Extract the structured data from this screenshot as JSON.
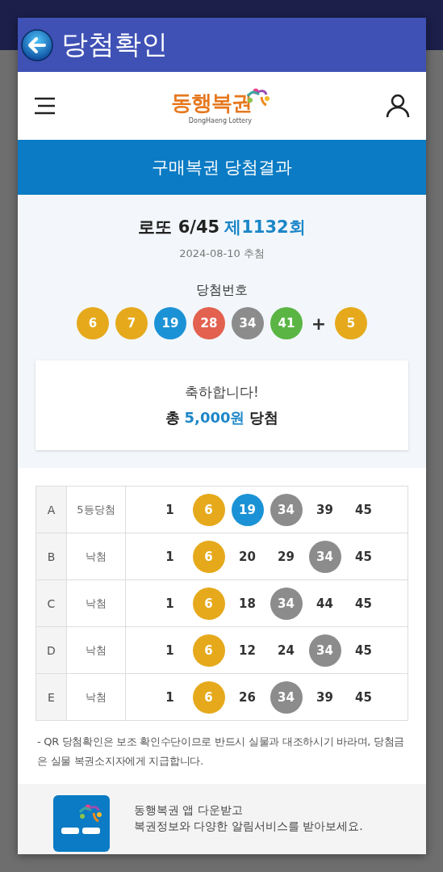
{
  "dialog": {
    "title": "당첨확인"
  },
  "site": {
    "logo": "동행복권",
    "logo_sub": "DongHaeng Lottery"
  },
  "banner": "구매복권 당첨결과",
  "draw": {
    "game": "로또 6/45",
    "round": "제1132회",
    "date": "2024-08-10 추첨",
    "numbers_label": "당첨번호",
    "balls": [
      {
        "n": "6",
        "color": "#e5a91b"
      },
      {
        "n": "7",
        "color": "#e5a91b"
      },
      {
        "n": "19",
        "color": "#1c92d6"
      },
      {
        "n": "28",
        "color": "#e2614f"
      },
      {
        "n": "34",
        "color": "#8c8c8c"
      },
      {
        "n": "41",
        "color": "#5ab545"
      }
    ],
    "plus": "+",
    "bonus": {
      "n": "5",
      "color": "#e5a91b"
    }
  },
  "result": {
    "greeting": "축하합니다!",
    "prefix": "총",
    "amount": "5,000원",
    "suffix": "당첨"
  },
  "tickets": [
    {
      "line": "A",
      "status": "5등당첨",
      "numbers": [
        {
          "n": "1"
        },
        {
          "n": "6",
          "color": "#e5a91b"
        },
        {
          "n": "19",
          "color": "#1c92d6"
        },
        {
          "n": "34",
          "color": "#8c8c8c"
        },
        {
          "n": "39"
        },
        {
          "n": "45"
        }
      ]
    },
    {
      "line": "B",
      "status": "낙첨",
      "numbers": [
        {
          "n": "1"
        },
        {
          "n": "6",
          "color": "#e5a91b"
        },
        {
          "n": "20"
        },
        {
          "n": "29"
        },
        {
          "n": "34",
          "color": "#8c8c8c"
        },
        {
          "n": "45"
        }
      ]
    },
    {
      "line": "C",
      "status": "낙첨",
      "numbers": [
        {
          "n": "1"
        },
        {
          "n": "6",
          "color": "#e5a91b"
        },
        {
          "n": "18"
        },
        {
          "n": "34",
          "color": "#8c8c8c"
        },
        {
          "n": "44"
        },
        {
          "n": "45"
        }
      ]
    },
    {
      "line": "D",
      "status": "낙첨",
      "numbers": [
        {
          "n": "1"
        },
        {
          "n": "6",
          "color": "#e5a91b"
        },
        {
          "n": "12"
        },
        {
          "n": "24"
        },
        {
          "n": "34",
          "color": "#8c8c8c"
        },
        {
          "n": "45"
        }
      ]
    },
    {
      "line": "E",
      "status": "낙첨",
      "numbers": [
        {
          "n": "1"
        },
        {
          "n": "6",
          "color": "#e5a91b"
        },
        {
          "n": "26"
        },
        {
          "n": "34",
          "color": "#8c8c8c"
        },
        {
          "n": "39"
        },
        {
          "n": "45"
        }
      ]
    }
  ],
  "note": "- QR 당첨확인은 보조 확인수단이므로 반드시 실물과 대조하시기 바라며, 당첨금은 실물 복권소지자에게 지급합니다.",
  "promo": {
    "lines": [
      "동행복권 앱 다운받고",
      "복권정보와 다양한 알림서비스를 받아보세요."
    ]
  }
}
